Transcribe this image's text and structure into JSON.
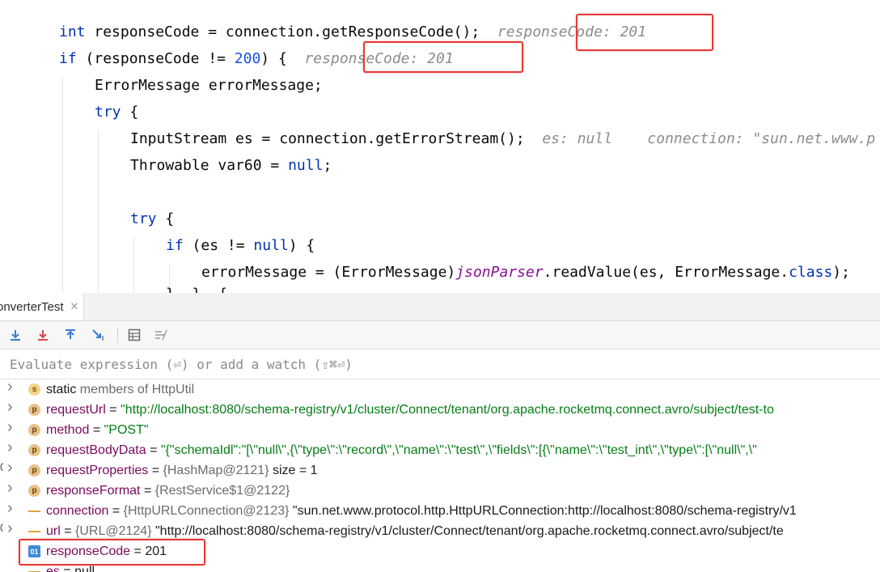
{
  "editor": {
    "lines": [
      {
        "key": "l1",
        "indent": 1,
        "tokens": [
          {
            "t": "int",
            "c": "kw"
          },
          {
            "t": " responseCode = connection.getResponseCode();  "
          },
          {
            "t": "responseCode: 201",
            "c": "hint"
          }
        ]
      },
      {
        "key": "l2",
        "indent": 1,
        "tokens": [
          {
            "t": "if",
            "c": "kw"
          },
          {
            "t": " (responseCode != "
          },
          {
            "t": "200",
            "c": "num"
          },
          {
            "t": ") {  "
          },
          {
            "t": "responseCode: 201",
            "c": "hint"
          }
        ]
      },
      {
        "key": "l3",
        "indent": 2,
        "tokens": [
          {
            "t": "ErrorMessage errorMessage;"
          }
        ]
      },
      {
        "key": "l4",
        "indent": 2,
        "tokens": [
          {
            "t": "try",
            "c": "kw"
          },
          {
            "t": " {"
          }
        ]
      },
      {
        "key": "l5",
        "indent": 3,
        "tokens": [
          {
            "t": "InputStream es = connection.getErrorStream();  "
          },
          {
            "t": "es: null",
            "c": "hint"
          },
          {
            "t": "    "
          },
          {
            "t": "connection: \"sun.net.www.p",
            "c": "hint"
          }
        ]
      },
      {
        "key": "l6",
        "indent": 3,
        "tokens": [
          {
            "t": "Throwable var60 = "
          },
          {
            "t": "null",
            "c": "kw"
          },
          {
            "t": ";"
          }
        ]
      },
      {
        "key": "l7",
        "indent": 3,
        "tokens": []
      },
      {
        "key": "l8",
        "indent": 3,
        "tokens": [
          {
            "t": "try",
            "c": "kw"
          },
          {
            "t": " {"
          }
        ]
      },
      {
        "key": "l9",
        "indent": 4,
        "tokens": [
          {
            "t": "if",
            "c": "kw"
          },
          {
            "t": " (es != "
          },
          {
            "t": "null",
            "c": "kw"
          },
          {
            "t": ") {"
          }
        ]
      },
      {
        "key": "l10",
        "indent": 5,
        "tokens": [
          {
            "t": "errorMessage = (ErrorMessage)"
          },
          {
            "t": "jsonParser",
            "c": "fld"
          },
          {
            "t": ".readValue(es, ErrorMessage."
          },
          {
            "t": "class",
            "c": "kw"
          },
          {
            "t": ");"
          }
        ]
      }
    ]
  },
  "debugger": {
    "tab_label": "onverterTest",
    "tab_close": "✕",
    "eval_placeholder": "Evaluate expression (⏎) or add a watch (⇧⌘⏎)",
    "variables": [
      {
        "icon": "s",
        "icon_text": "s",
        "name": "static",
        "parts": [
          {
            "t": " members of HttpUtil",
            "c": "vtype"
          }
        ],
        "expandable": true,
        "gutter": ""
      },
      {
        "icon": "p",
        "icon_text": "p",
        "name": "requestUrl",
        "parts": [
          {
            "t": " = "
          },
          {
            "t": "\"http://localhost:8080/schema-registry/v1/cluster/Connect/tenant/org.apache.rocketmq.connect.avro/subject/test-to",
            "c": "vstr"
          }
        ],
        "expandable": true,
        "gutter": ""
      },
      {
        "icon": "p",
        "icon_text": "p",
        "name": "method",
        "parts": [
          {
            "t": " = "
          },
          {
            "t": "\"POST\"",
            "c": "vstr"
          }
        ],
        "expandable": true,
        "gutter": ""
      },
      {
        "icon": "p",
        "icon_text": "p",
        "name": "requestBodyData",
        "parts": [
          {
            "t": " = "
          },
          {
            "t": "\"{\"schemaIdl\":\"[\\\"null\\\",{\\\"type\\\":\\\"record\\\",\\\"name\\\":\\\"test\\\",\\\"fields\\\":[{\\\"name\\\":\\\"test_int\\\",\\\"type\\\":[\\\"null\\\",\\\"",
            "c": "vstr"
          }
        ],
        "expandable": true,
        "gutter": ""
      },
      {
        "icon": "p",
        "icon_text": "p",
        "name": "requestProperties",
        "parts": [
          {
            "t": " = "
          },
          {
            "t": "{HashMap@2121}",
            "c": "vtype"
          },
          {
            "t": "  size = 1"
          }
        ],
        "expandable": true,
        "gutter": "0"
      },
      {
        "icon": "p",
        "icon_text": "p",
        "name": "responseFormat",
        "parts": [
          {
            "t": " = "
          },
          {
            "t": "{RestService$1@2122}",
            "c": "vtype"
          }
        ],
        "expandable": true,
        "gutter": ""
      },
      {
        "icon": "f",
        "icon_text": "",
        "name": "connection",
        "parts": [
          {
            "t": " = "
          },
          {
            "t": "{HttpURLConnection@2123}",
            "c": "vtype"
          },
          {
            "t": " \"sun.net.www.protocol.http.HttpURLConnection:http://localhost:8080/schema-registry/v1"
          }
        ],
        "expandable": true,
        "gutter": ""
      },
      {
        "icon": "f",
        "icon_text": "",
        "name": "url",
        "parts": [
          {
            "t": " = "
          },
          {
            "t": "{URL@2124}",
            "c": "vtype"
          },
          {
            "t": " \"http://localhost:8080/schema-registry/v1/cluster/Connect/tenant/org.apache.rocketmq.connect.avro/subject/te"
          }
        ],
        "expandable": true,
        "gutter": "0"
      },
      {
        "icon": "01",
        "icon_text": "01",
        "name": "responseCode",
        "parts": [
          {
            "t": " = "
          },
          {
            "t": "201",
            "c": "vplain"
          }
        ],
        "expandable": false,
        "gutter": ""
      },
      {
        "icon": "f",
        "icon_text": "",
        "name": "es",
        "parts": [
          {
            "t": " = "
          },
          {
            "t": "null",
            "c": "vplain"
          }
        ],
        "expandable": false,
        "gutter": ""
      }
    ]
  },
  "colors": {
    "highlight": "#e53935",
    "keyword": "#0033b3",
    "number": "#1750eb",
    "string": "#067d17",
    "hint": "#8c8c8c"
  }
}
